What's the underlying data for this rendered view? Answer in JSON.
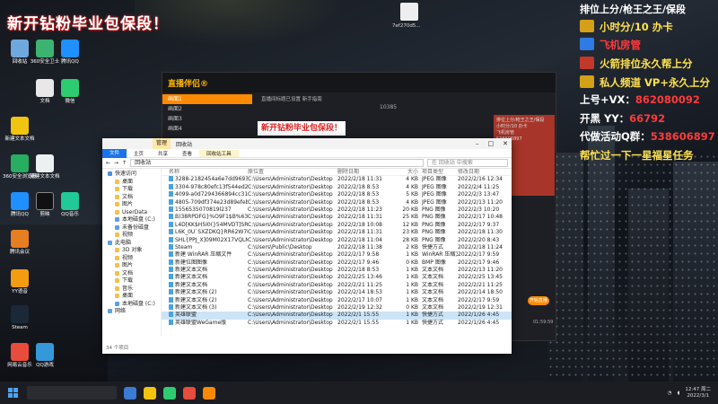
{
  "banner": {
    "top_left": "新开钻粉毕业包保段！",
    "inner": "新开钻粉毕业包保段！"
  },
  "ads": {
    "line1": "排位上分/枪王之王/保段",
    "line2": "小时分/10 办卡",
    "line3": "飞机房管",
    "line4": "火箭排位永久帮上分",
    "line5": "私人频道 VP+永久上分",
    "line6_label": "上号+VX：",
    "line6_value": "862080092",
    "line7_label": "开黑 YY：",
    "line7_value": "66792",
    "line8_label": "代做活动Q群：",
    "line8_value": "538606897",
    "line9": "帮忙过一下一星福星任务",
    "colors": {
      "yellow": "#ffe14d",
      "white": "#ffffff",
      "red": "#ff3b3b"
    }
  },
  "desktop_icons": [
    {
      "label": "回收站"
    },
    {
      "label": "360安全卫士"
    },
    {
      "label": "腾讯QQ"
    },
    {
      "label": "文档"
    },
    {
      "label": "微信"
    },
    {
      "label": "新建文本文档"
    },
    {
      "label": "360安全浏览器"
    },
    {
      "label": "新建文本文档"
    },
    {
      "label": "剪映"
    },
    {
      "label": "腾讯QQ"
    },
    {
      "label": "QQ音乐"
    },
    {
      "label": "腾讯会议"
    },
    {
      "label": "YY语音"
    },
    {
      "label": "Steam"
    },
    {
      "label": "网易云音乐"
    },
    {
      "label": "QQ游戏"
    }
  ],
  "desktop_thumb": {
    "label": "7ef270d5..."
  },
  "live_app": {
    "brand": "直播伴侣",
    "brand_suffix": "®",
    "tabs": [
      "画面1",
      "画面2",
      "画面3",
      "画面4"
    ],
    "note": "直播间标题已设置  新手指南",
    "viewer_info": "10385",
    "overlay_lines": [
      "排位上分/枪王之王/保段",
      "小时分/10 办卡",
      "飞机房管",
      "538606897"
    ],
    "live_button": "开始直播",
    "timer": "01:59:59"
  },
  "explorer": {
    "title": "回收站",
    "manage_tab": "管理",
    "ribbon": [
      "文件",
      "主页",
      "共享",
      "查看",
      "回收站工具"
    ],
    "address": "回收站",
    "search_placeholder": "在 回收站 中搜索",
    "nav": [
      {
        "label": "快速访问",
        "kind": "star",
        "indent": false
      },
      {
        "label": "桌面",
        "kind": "folder",
        "indent": true
      },
      {
        "label": "下载",
        "kind": "folder",
        "indent": true
      },
      {
        "label": "文档",
        "kind": "folder",
        "indent": true
      },
      {
        "label": "图片",
        "kind": "folder",
        "indent": true
      },
      {
        "label": "UserData",
        "kind": "folder",
        "indent": true
      },
      {
        "label": "本地磁盘 (C:)",
        "kind": "pc",
        "indent": true
      },
      {
        "label": "未备份磁盘",
        "kind": "pc",
        "indent": true
      },
      {
        "label": "视频",
        "kind": "folder",
        "indent": true
      },
      {
        "label": "此电脑",
        "kind": "pc",
        "indent": false
      },
      {
        "label": "3D 对象",
        "kind": "folder",
        "indent": true
      },
      {
        "label": "视频",
        "kind": "folder",
        "indent": true
      },
      {
        "label": "图片",
        "kind": "folder",
        "indent": true
      },
      {
        "label": "文档",
        "kind": "folder",
        "indent": true
      },
      {
        "label": "下载",
        "kind": "folder",
        "indent": true
      },
      {
        "label": "音乐",
        "kind": "folder",
        "indent": true
      },
      {
        "label": "桌面",
        "kind": "folder",
        "indent": true
      },
      {
        "label": "本地磁盘 (C:)",
        "kind": "pc",
        "indent": true
      },
      {
        "label": "网络",
        "kind": "pc",
        "indent": false
      }
    ],
    "columns": [
      "名称",
      "原位置",
      "删除日期",
      "大小",
      "项目类型",
      "修改日期"
    ],
    "rows": [
      [
        "3288-2182454a6e7dd969390630...",
        "C:\\Users\\Administrator\\Desktop",
        "2022/2/18 11:31",
        "4 KB",
        "JPEG 图像",
        "2022/2/16 12:34"
      ],
      [
        "3304-978c80efc13f544ed28459...",
        "C:\\Users\\Administrator\\Desktop",
        "2022/2/18 8:53",
        "4 KB",
        "JPEG 图像",
        "2022/2/4 11:25"
      ],
      [
        "4099-a0d7294366894cc31ddf5...",
        "C:\\Users\\Administrator\\Desktop",
        "2022/2/18 8:53",
        "5 KB",
        "JPEG 图像",
        "2022/2/3 13:47"
      ],
      [
        "4805-709df374e23d89efeb3f59...",
        "C:\\Users\\Administrator\\Desktop",
        "2022/2/18 8:53",
        "4 KB",
        "JPEG 图像",
        "2022/2/13 11:20"
      ],
      [
        "1556535070819l237",
        "C:\\Users\\Administrator\\Desktop",
        "2022/2/18 11:23",
        "20 KB",
        "PNG 图像",
        "2022/2/3 10:20"
      ],
      [
        "B)38RPDFG}%O9F1$B%63L",
        "C:\\Users\\Administrator\\Desktop",
        "2022/2/18 11:31",
        "25 KB",
        "PNG 图像",
        "2022/2/17 10:48"
      ],
      [
        "L4D[KK$H5I0(}54MVDT]SRO8",
        "C:\\Users\\Administrator\\Desktop",
        "2022/2/18 10:08",
        "12 KB",
        "PNG 图像",
        "2022/2/17 9:37"
      ],
      [
        "L6K_0U`SXZDKQ}RR62W7RX[1",
        "C:\\Users\\Administrator\\Desktop",
        "2022/2/18 11:31",
        "23 KB",
        "PNG 图像",
        "2022/2/18 11:30"
      ],
      [
        "SHL{PPJ_X]09M02X17VQLM~1",
        "C:\\Users\\Administrator\\Desktop",
        "2022/2/18 11:04",
        "28 KB",
        "PNG 图像",
        "2022/2/20 8:43"
      ],
      [
        "Steam",
        "C:\\Users\\Public\\Desktop",
        "2022/2/18 11:38",
        "2 KB",
        "快捷方式",
        "2022/2/18 11:24"
      ],
      [
        "新建 WinRAR 压缩文件",
        "C:\\Users\\Administrator\\Desktop",
        "2022/2/17 9:58",
        "1 KB",
        "WinRAR 压缩文件",
        "2022/2/17 9:59"
      ],
      [
        "新建位图图像",
        "C:\\Users\\Administrator\\Desktop",
        "2022/2/17 9:46",
        "0 KB",
        "BMP 图像",
        "2022/2/17 9:46"
      ],
      [
        "新建文本文档",
        "C:\\Users\\Administrator\\Desktop",
        "2022/2/18 8:53",
        "1 KB",
        "文本文档",
        "2022/2/13 11:20"
      ],
      [
        "新建文本文档",
        "C:\\Users\\Administrator\\Desktop",
        "2022/2/25 13:46",
        "1 KB",
        "文本文档",
        "2022/2/25 13:45"
      ],
      [
        "新建文本文档",
        "C:\\Users\\Administrator\\Desktop",
        "2022/2/21 11:25",
        "1 KB",
        "文本文档",
        "2022/2/21 11:25"
      ],
      [
        "新建文本文档 (2)",
        "C:\\Users\\Administrator\\Desktop",
        "2022/2/14 18:53",
        "1 KB",
        "文本文档",
        "2022/2/14 18:50"
      ],
      [
        "新建文本文档 (2)",
        "C:\\Users\\Administrator\\Desktop",
        "2022/2/17 10:07",
        "1 KB",
        "文本文档",
        "2022/2/17 9:59"
      ],
      [
        "新建文本文档 (3)",
        "C:\\Users\\Administrator\\Desktop",
        "2022/2/19 12:32",
        "0 KB",
        "文本文档",
        "2022/2/19 12:31"
      ],
      [
        "英雄联盟",
        "C:\\Users\\Administrator\\Desktop",
        "2022/2/1 15:55",
        "1 KB",
        "快捷方式",
        "2022/1/26 4:45"
      ],
      [
        "英雄联盟WeGame版",
        "C:\\Users\\Administrator\\Desktop",
        "2022/2/1 15:55",
        "1 KB",
        "快捷方式",
        "2022/1/26 4:45"
      ]
    ],
    "status": "34 个项目"
  },
  "taskbar": {
    "time": "12:47 周二",
    "date": "2022/3/1"
  }
}
